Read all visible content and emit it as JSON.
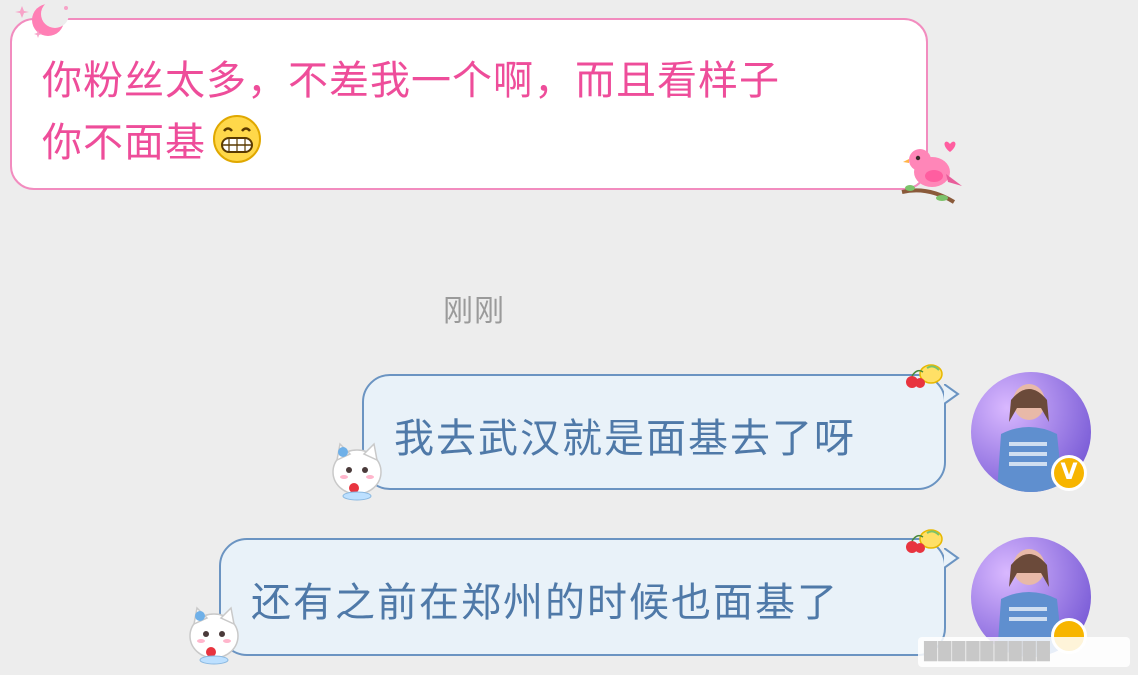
{
  "conversation": {
    "incoming": {
      "text": "你粉丝太多，不差我一个啊，而且看样子你不面基",
      "line1": "你粉丝太多，不差我一个啊，而且看样子",
      "line2": "你不面基",
      "emoji": "grinning-face",
      "accent_color": "#ee4d9a",
      "border_color": "#f28cbf"
    },
    "time_divider": "刚刚",
    "outgoing": [
      {
        "text": "我去武汉就是面基去了呀"
      },
      {
        "text": "还有之前在郑州的时候也面基了"
      }
    ],
    "outgoing_text_color": "#4f79a8",
    "outgoing_border_color": "#6b94c2",
    "avatar_badge": "V"
  },
  "watermark": {
    "text": "█████████"
  },
  "icons": {
    "incoming_top_decor": "pink-moon-sparkle-icon",
    "incoming_corner_decor": "pink-bird-on-branch-icon",
    "outgoing_corner_decor": "cherry-lemon-icon",
    "outgoing_side_decor": "white-cat-sticker-icon",
    "avatar": "user-avatar-icon",
    "verified_badge": "verified-v-badge-icon"
  }
}
